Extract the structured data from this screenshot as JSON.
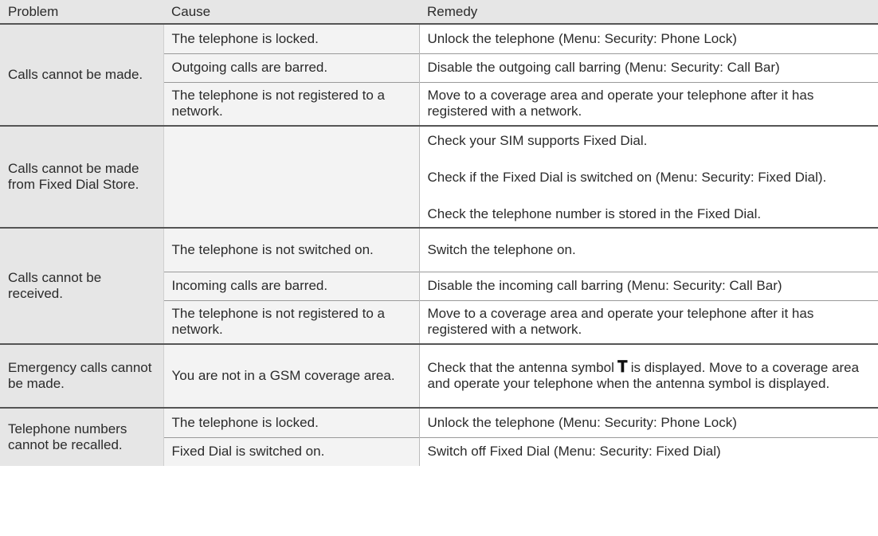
{
  "header": {
    "problem": "Problem",
    "cause": "Cause",
    "remedy": "Remedy"
  },
  "rows": {
    "r0": {
      "problem": "Calls cannot be made.",
      "cause": "The telephone is locked.",
      "remedy": "Unlock the telephone (Menu: Security: Phone Lock)"
    },
    "r1": {
      "cause": "Outgoing calls are barred.",
      "remedy": "Disable the outgoing call barring (Menu: Security: Call Bar)"
    },
    "r2": {
      "cause": "The telephone is not registered to a network.",
      "remedy": "Move to a coverage area and operate your telephone after it has registered with a network."
    },
    "r3": {
      "problem": "Calls cannot be made from Fixed Dial Store.",
      "cause": "",
      "remedy": "Check your SIM supports Fixed Dial."
    },
    "r4": {
      "remedy": "Check if the Fixed Dial is switched on (Menu: Security: Fixed Dial)."
    },
    "r5": {
      "remedy": "Check the telephone number is stored in the Fixed Dial."
    },
    "r6": {
      "problem": "Calls cannot be received.",
      "cause": "The telephone is not switched on.",
      "remedy": "Switch the telephone on."
    },
    "r7": {
      "cause": "Incoming calls are barred.",
      "remedy": "Disable the incoming call barring (Menu: Security: Call Bar)"
    },
    "r8": {
      "cause": "The telephone is not registered to a network.",
      "remedy": "Move to a coverage area and operate your telephone after it has registered with a network."
    },
    "r9": {
      "problem": "Emergency calls cannot be made.",
      "cause": "You are not in a GSM coverage area.",
      "remedy_before": "Check that the antenna symbol",
      "remedy_icon": "antenna-signal-icon",
      "remedy_after": "is displayed. Move to a coverage area and operate your telephone when the antenna symbol is displayed."
    },
    "r10": {
      "problem": "Telephone numbers cannot be recalled.",
      "cause": "The telephone is locked.",
      "remedy": "Unlock the telephone (Menu: Security: Phone Lock)"
    },
    "r11": {
      "cause": "Fixed Dial is switched on.",
      "remedy": "Switch off Fixed Dial (Menu: Security: Fixed Dial)"
    }
  },
  "colors": {
    "problem_bg": "#e6e6e6",
    "cause_bg": "#f3f3f3",
    "separator": "#555555",
    "text": "#2b2b2b"
  }
}
